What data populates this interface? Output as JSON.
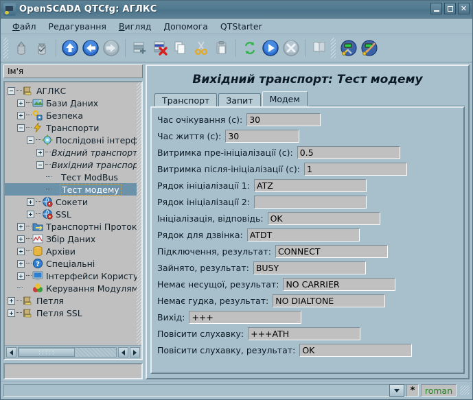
{
  "window": {
    "title": "OpenSCADA QTCfg: АГЛКС",
    "icon": "app-icon",
    "buttons": {
      "minimize": "_",
      "maximize": "□",
      "close": "✕"
    }
  },
  "menubar": {
    "items": [
      {
        "label": "Файл",
        "mnemonic": "Ф"
      },
      {
        "label": "Редагування",
        "mnemonic": "Р"
      },
      {
        "label": "Вигляд",
        "mnemonic": "В"
      },
      {
        "label": "Допомога",
        "mnemonic": "Д"
      },
      {
        "label": "QTStarter",
        "mnemonic": ""
      }
    ]
  },
  "toolbar": {
    "items": [
      {
        "name": "load-from-db-icon",
        "title": "Завантажити з БД",
        "enabled": false
      },
      {
        "name": "save-to-db-icon",
        "title": "Зберегти до БД",
        "enabled": false
      },
      {
        "name": "up-icon",
        "title": "Вгору",
        "enabled": true
      },
      {
        "name": "back-icon",
        "title": "Назад",
        "enabled": true
      },
      {
        "name": "forward-icon",
        "title": "Вперед",
        "enabled": false
      },
      {
        "name": "add-node-icon",
        "title": "Додати вузол",
        "enabled": true
      },
      {
        "name": "delete-node-icon",
        "title": "Видалити вузол",
        "enabled": true
      },
      {
        "name": "copy-icon",
        "title": "Копіювати",
        "enabled": true
      },
      {
        "name": "cut-icon",
        "title": "Вирізати",
        "enabled": true
      },
      {
        "name": "paste-icon",
        "title": "Вставити",
        "enabled": true
      },
      {
        "name": "refresh-icon",
        "title": "Оновити",
        "enabled": true
      },
      {
        "name": "start-icon",
        "title": "Запустити",
        "enabled": true
      },
      {
        "name": "stop-icon",
        "title": "Зупинити",
        "enabled": false
      },
      {
        "name": "manual-icon",
        "title": "Посібник",
        "enabled": false
      },
      {
        "name": "config-tool-icon",
        "title": "Конфігуратор",
        "enabled": true
      },
      {
        "name": "config-edit-icon",
        "title": "Редактор",
        "enabled": true
      }
    ]
  },
  "tree": {
    "header": "Ім'я",
    "items": [
      {
        "label": "АГЛКС",
        "depth": 0,
        "expander": "minus",
        "icon": "flag-icon",
        "italic": false,
        "selected": false
      },
      {
        "label": "Бази Даних",
        "depth": 1,
        "expander": "plus",
        "icon": "db-icon",
        "italic": false,
        "selected": false
      },
      {
        "label": "Безпека",
        "depth": 1,
        "expander": "plus",
        "icon": "keys-icon",
        "italic": false,
        "selected": false
      },
      {
        "label": "Транспорти",
        "depth": 1,
        "expander": "minus",
        "icon": "bolt-icon",
        "italic": false,
        "selected": false
      },
      {
        "label": "Послідовні інтерфейси",
        "depth": 2,
        "expander": "minus",
        "icon": "serial-icon",
        "italic": false,
        "selected": false
      },
      {
        "label": "Вхідний транспорт",
        "depth": 3,
        "expander": "plus",
        "icon": "none",
        "italic": true,
        "selected": false
      },
      {
        "label": "Вихідний транспорт",
        "depth": 3,
        "expander": "minus",
        "icon": "none",
        "italic": true,
        "selected": false
      },
      {
        "label": "Тест ModBus",
        "depth": 4,
        "expander": "none",
        "icon": "none",
        "italic": false,
        "selected": false
      },
      {
        "label": "Тест модему",
        "depth": 4,
        "expander": "none",
        "icon": "none",
        "italic": false,
        "selected": true
      },
      {
        "label": "Сокети",
        "depth": 2,
        "expander": "plus",
        "icon": "socket-icon",
        "italic": false,
        "selected": false
      },
      {
        "label": "SSL",
        "depth": 2,
        "expander": "plus",
        "icon": "ssl-icon",
        "italic": false,
        "selected": false
      },
      {
        "label": "Транспортні Протоколи",
        "depth": 1,
        "expander": "plus",
        "icon": "proto-icon",
        "italic": false,
        "selected": false
      },
      {
        "label": "Збір Даних",
        "depth": 1,
        "expander": "plus",
        "icon": "daq-icon",
        "italic": false,
        "selected": false
      },
      {
        "label": "Архіви",
        "depth": 1,
        "expander": "plus",
        "icon": "archive-icon",
        "italic": false,
        "selected": false
      },
      {
        "label": "Спеціальні",
        "depth": 1,
        "expander": "plus",
        "icon": "special-icon",
        "italic": false,
        "selected": false
      },
      {
        "label": "Інтерфейси Користувача",
        "depth": 1,
        "expander": "plus",
        "icon": "ui-icon",
        "italic": false,
        "selected": false
      },
      {
        "label": "Керування Модулями",
        "depth": 1,
        "expander": "none",
        "icon": "modules-icon",
        "italic": false,
        "selected": false
      },
      {
        "label": "Петля",
        "depth": 0,
        "expander": "plus",
        "icon": "flag-icon",
        "italic": false,
        "selected": false
      },
      {
        "label": "Петля SSL",
        "depth": 0,
        "expander": "plus",
        "icon": "flag-icon",
        "italic": false,
        "selected": false
      }
    ],
    "status_text": ""
  },
  "main": {
    "page_title": "Вихідний транспорт: Тест модему",
    "tabs": [
      {
        "label": "Транспорт",
        "active": false
      },
      {
        "label": "Запит",
        "active": false
      },
      {
        "label": "Модем",
        "active": true
      }
    ],
    "fields": [
      {
        "label": "Час очікування (с):",
        "value": "30",
        "width": "sm"
      },
      {
        "label": "Час життя (с):",
        "value": "30",
        "width": "sm"
      },
      {
        "label": "Витримка пре-ініціалізації (с):",
        "value": "0.5",
        "width": "md"
      },
      {
        "label": "Витримка після-ініціалізації (с):",
        "value": "1",
        "width": "md"
      },
      {
        "label": "Рядок ініціалізації 1:",
        "value": "ATZ",
        "width": "grow"
      },
      {
        "label": "Рядок ініціалізації 2:",
        "value": "",
        "width": "grow"
      },
      {
        "label": "Ініціалізація, відповідь:",
        "value": "OK",
        "width": "grow"
      },
      {
        "label": "Рядок для дзвінка:",
        "value": "ATDT",
        "width": "grow"
      },
      {
        "label": "Підключення, результат:",
        "value": "CONNECT",
        "width": "grow"
      },
      {
        "label": "Зайнято, результат:",
        "value": "BUSY",
        "width": "grow"
      },
      {
        "label": "Немає несущої, результат:",
        "value": "NO CARRIER",
        "width": "grow"
      },
      {
        "label": "Немає гудка, результат:",
        "value": "NO DIALTONE",
        "width": "grow"
      },
      {
        "label": "Вихід:",
        "value": "+++",
        "width": "grow"
      },
      {
        "label": "Повісити слухавку:",
        "value": "+++ATH",
        "width": "grow"
      },
      {
        "label": "Повісити слухавку, результат:",
        "value": "OK",
        "width": "grow"
      }
    ]
  },
  "statusbar": {
    "message": "",
    "combo_icon": "chevron-down-icon",
    "modified_flag": "*",
    "user": "roman"
  },
  "colors": {
    "window_bg": "#a8c0cc",
    "titlebar": "#51788d",
    "field_bg": "#c0c0c0",
    "selection": "#6c92aa",
    "user_text": "#1f8a1f",
    "text": "#0b1a24"
  }
}
